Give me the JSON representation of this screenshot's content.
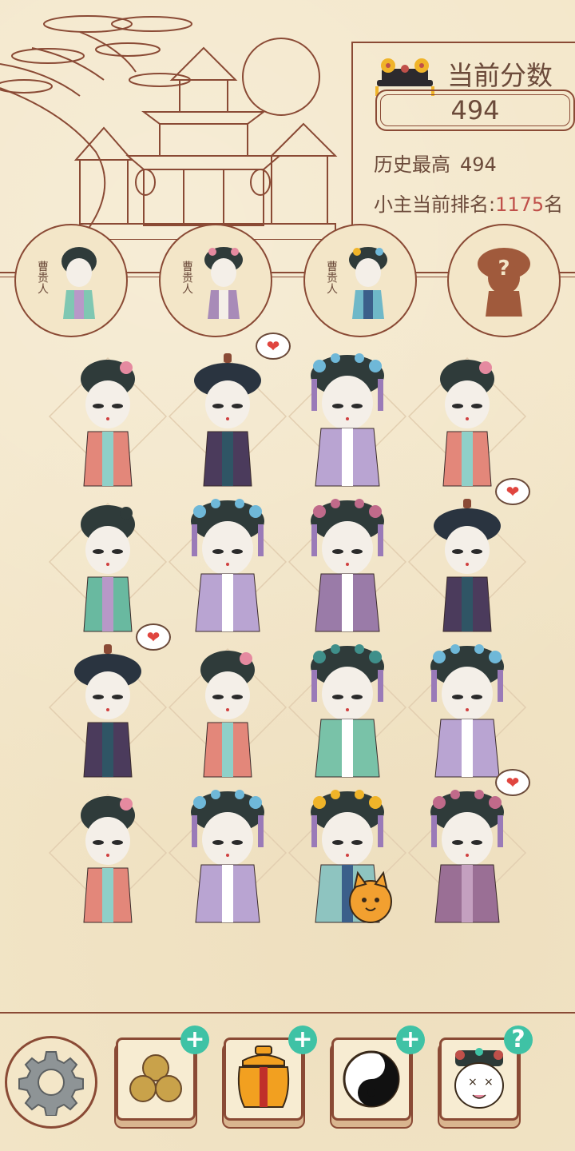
{
  "score": {
    "title": "当前分数",
    "current": "494",
    "best_label": "历史最高",
    "best_value": "494",
    "rank_label": "小主当前排名:",
    "rank_value": "1175",
    "rank_suffix": "名"
  },
  "progress": {
    "items": [
      {
        "label": "曹贵人",
        "state": "unlocked"
      },
      {
        "label": "曹贵人",
        "state": "unlocked"
      },
      {
        "label": "曹贵人",
        "state": "unlocked"
      },
      {
        "label": "?",
        "state": "locked"
      }
    ]
  },
  "grid": {
    "rows": [
      [
        "maid",
        "eunuch",
        "consort-purple",
        "maid"
      ],
      [
        "girl-teal",
        "consort-purple",
        "consort-pink",
        "eunuch"
      ],
      [
        "eunuch",
        "maid",
        "consort-teal",
        "consort-purple"
      ],
      [
        "maid",
        "consort-purple",
        "empress-cat",
        "lady-pink"
      ]
    ],
    "hearts": [
      "r0c1",
      "r1c3",
      "r2c0",
      "r3c3"
    ]
  },
  "toolbar": {
    "icons": [
      "gear-icon",
      "coins-icon",
      "jar-icon",
      "yin-yang-icon",
      "jester-icon"
    ],
    "plus": "+",
    "help": "?"
  },
  "colors": {
    "bg": "#f3e6c8",
    "line": "#8a4a35",
    "accent_red": "#c0504a",
    "plus_teal": "#3fc2a5",
    "heart": "#e0453f"
  }
}
